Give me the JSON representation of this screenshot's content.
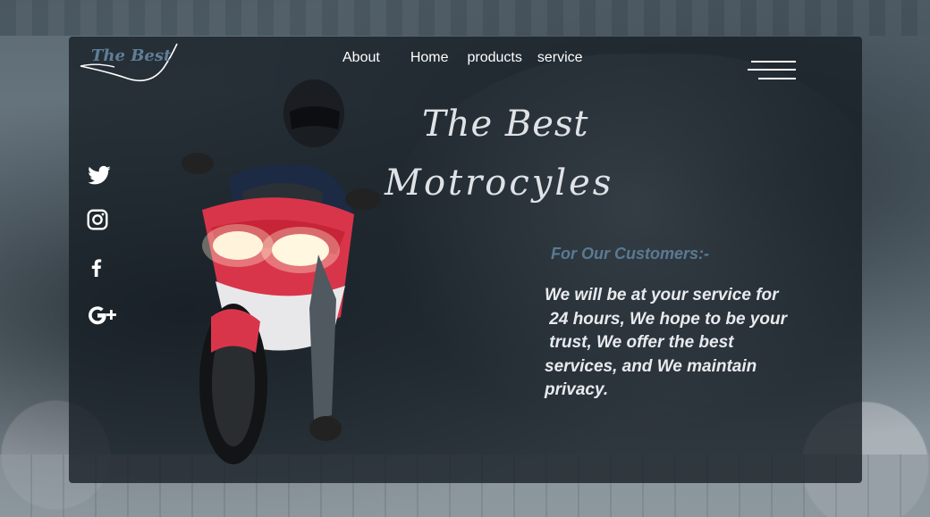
{
  "logo": {
    "text": "The Best"
  },
  "nav": {
    "items": [
      {
        "label": "About"
      },
      {
        "label": "Home"
      },
      {
        "label": "products"
      },
      {
        "label": "service"
      }
    ]
  },
  "menu": {
    "icon": "hamburger-menu-icon"
  },
  "hero": {
    "line1": "The Best",
    "line2": "Motrocyles"
  },
  "social": [
    {
      "icon": "twitter-icon"
    },
    {
      "icon": "instagram-icon"
    },
    {
      "icon": "facebook-icon"
    },
    {
      "icon": "google-plus-icon"
    }
  ],
  "customers": {
    "title": "For Our Customers:-",
    "text": "We will be at your service for\n 24 hours, We hope to be your\n trust, We offer the best\nservices, and We maintain\nprivacy."
  },
  "colors": {
    "panel": "#161e24",
    "accent": "#5f7e98",
    "text": "#ffffff"
  }
}
